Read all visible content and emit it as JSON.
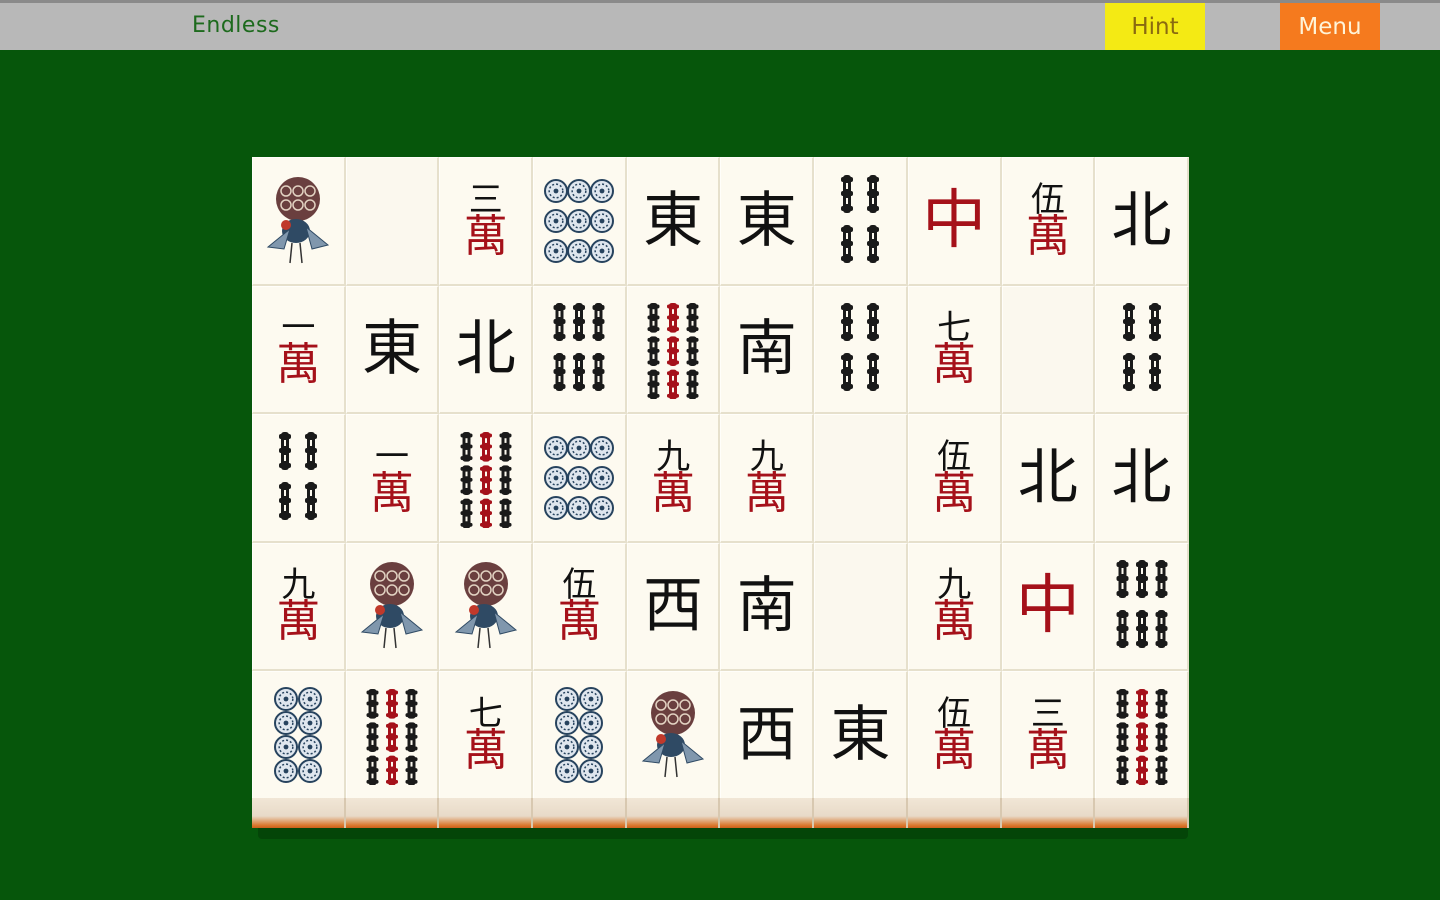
{
  "header": {
    "title": "Endless",
    "hint_label": "Hint",
    "menu_label": "Menu"
  },
  "colors": {
    "felt": "#06560b",
    "topbar": "#b8b8b8",
    "hint": "#f4ea14",
    "menu": "#f57a1e",
    "tile": "#fdfaf0",
    "red": "#a5111a"
  },
  "board": {
    "rows": [
      [
        {
          "type": "bird"
        },
        {
          "type": "blank"
        },
        {
          "type": "char",
          "num": "三",
          "wan": "萬"
        },
        {
          "type": "circles9"
        },
        {
          "type": "wind",
          "char": "東"
        },
        {
          "type": "wind",
          "char": "東"
        },
        {
          "type": "bamboo6"
        },
        {
          "type": "dragon",
          "char": "中"
        },
        {
          "type": "char",
          "num": "伍",
          "wan": "萬"
        },
        {
          "type": "wind",
          "char": "北"
        }
      ],
      [
        {
          "type": "char",
          "num": "一",
          "wan": "萬"
        },
        {
          "type": "wind",
          "char": "東"
        },
        {
          "type": "wind",
          "char": "北"
        },
        {
          "type": "bamboo8"
        },
        {
          "type": "bamboo9"
        },
        {
          "type": "wind",
          "char": "南"
        },
        {
          "type": "bamboo6"
        },
        {
          "type": "char",
          "num": "七",
          "wan": "萬"
        },
        {
          "type": "blank"
        },
        {
          "type": "bamboo6"
        }
      ],
      [
        {
          "type": "bamboo4"
        },
        {
          "type": "char",
          "num": "一",
          "wan": "萬"
        },
        {
          "type": "bamboo9"
        },
        {
          "type": "circles9"
        },
        {
          "type": "char",
          "num": "九",
          "wan": "萬"
        },
        {
          "type": "char",
          "num": "九",
          "wan": "萬"
        },
        {
          "type": "blank"
        },
        {
          "type": "char",
          "num": "伍",
          "wan": "萬"
        },
        {
          "type": "wind",
          "char": "北"
        },
        {
          "type": "wind",
          "char": "北"
        }
      ],
      [
        {
          "type": "char",
          "num": "九",
          "wan": "萬"
        },
        {
          "type": "bird"
        },
        {
          "type": "bird"
        },
        {
          "type": "char",
          "num": "伍",
          "wan": "萬"
        },
        {
          "type": "wind",
          "char": "西"
        },
        {
          "type": "wind",
          "char": "南"
        },
        {
          "type": "blank"
        },
        {
          "type": "char",
          "num": "九",
          "wan": "萬"
        },
        {
          "type": "dragon",
          "char": "中"
        },
        {
          "type": "bamboo8"
        }
      ],
      [
        {
          "type": "circles8"
        },
        {
          "type": "bamboo9"
        },
        {
          "type": "char",
          "num": "七",
          "wan": "萬"
        },
        {
          "type": "circles8"
        },
        {
          "type": "bird"
        },
        {
          "type": "wind",
          "char": "西"
        },
        {
          "type": "wind",
          "char": "東"
        },
        {
          "type": "char",
          "num": "伍",
          "wan": "萬"
        },
        {
          "type": "char",
          "num": "三",
          "wan": "萬"
        },
        {
          "type": "bamboo9"
        }
      ]
    ]
  }
}
